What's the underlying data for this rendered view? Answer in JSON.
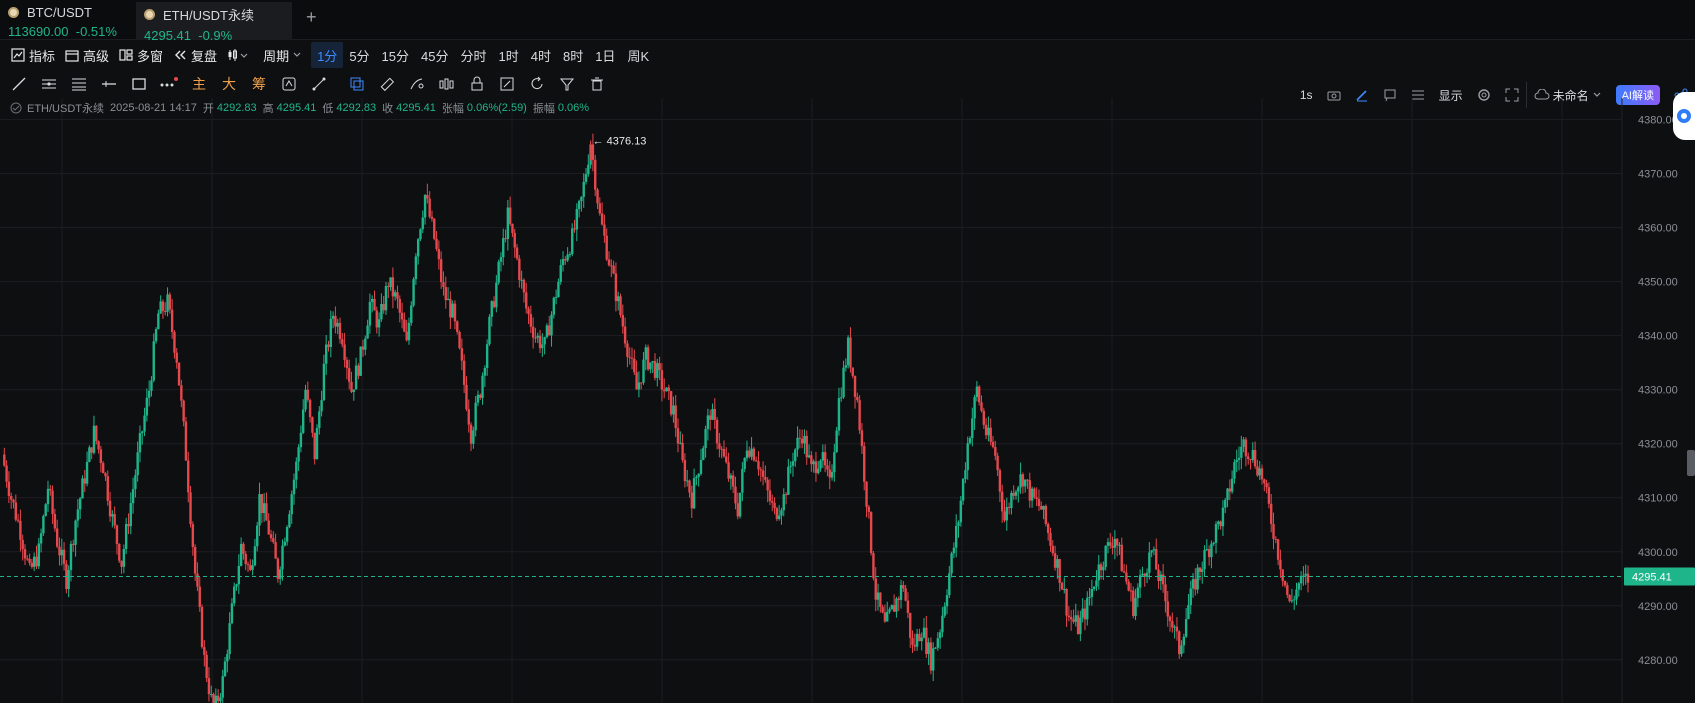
{
  "tabs": [
    {
      "name": "BTC/USDT",
      "price": "113690.00",
      "change": "-0.51%"
    },
    {
      "name": "ETH/USDT永续",
      "price": "4295.41",
      "change": "-0.9%"
    }
  ],
  "toolbar": {
    "indicator": "指标",
    "advanced": "高级",
    "multi_window": "多窗",
    "replay": "复盘",
    "period_menu": "周期",
    "periods": [
      "1分",
      "5分",
      "15分",
      "45分",
      "分时",
      "1时",
      "4时",
      "8时",
      "1日",
      "周K"
    ],
    "active_period": "1分"
  },
  "right_tools": {
    "interval": "1s",
    "display": "显示",
    "layout_name": "未命名",
    "ai_label": "AI解读"
  },
  "drawing_tools": {
    "main_label": "主",
    "big_label": "大",
    "chip_label": "筹"
  },
  "info_bar": {
    "symbol": "ETH/USDT永续",
    "datetime": "2025-08-21 14:17",
    "open_label": "开",
    "open": "4292.83",
    "high_label": "高",
    "high": "4295.41",
    "low_label": "低",
    "low": "4292.83",
    "close_label": "收",
    "close": "4295.41",
    "change_label": "张幅",
    "change": "0.06%(2.59)",
    "amplitude_label": "振幅",
    "amplitude": "0.06%"
  },
  "chart_data": {
    "type": "line",
    "title": "",
    "y_ticks": [
      4280,
      4290,
      4300,
      4310,
      4320,
      4330,
      4340,
      4350,
      4360,
      4370,
      4380
    ],
    "ylim": [
      4272,
      4384
    ],
    "current_price": 4295.41,
    "max_marker": 4376.13,
    "colors": {
      "up": "#1fb58b",
      "down": "#e5484d",
      "grid": "#1c1e22",
      "axis_text": "#8a8f96"
    },
    "series": [
      {
        "values": [
          4318,
          4310,
          4304,
          4296,
          4300,
          4312,
          4302,
          4295,
          4306,
          4314,
          4322,
          4316,
          4306,
          4298,
          4309,
          4320,
          4330,
          4344,
          4346,
          4336,
          4318,
          4296,
          4280,
          4270,
          4276,
          4289,
          4301,
          4296,
          4310,
          4304,
          4296,
          4306,
          4316,
          4330,
          4318,
          4334,
          4344,
          4340,
          4330,
          4336,
          4346,
          4342,
          4350,
          4346,
          4338,
          4356,
          4366,
          4358,
          4348,
          4344,
          4334,
          4322,
          4330,
          4342,
          4352,
          4362,
          4354,
          4345,
          4340,
          4338,
          4346,
          4354,
          4358,
          4365,
          4376,
          4362,
          4354,
          4346,
          4338,
          4330,
          4336,
          4334,
          4330,
          4326,
          4316,
          4310,
          4318,
          4326,
          4320,
          4314,
          4308,
          4320,
          4318,
          4312,
          4307,
          4310,
          4318,
          4322,
          4315,
          4318,
          4312,
          4328,
          4338,
          4328,
          4310,
          4292,
          4286,
          4290,
          4294,
          4282,
          4286,
          4280,
          4286,
          4296,
          4306,
          4320,
          4330,
          4322,
          4318,
          4306,
          4312,
          4314,
          4310,
          4308,
          4302,
          4296,
          4288,
          4286,
          4290,
          4296,
          4300,
          4303,
          4296,
          4290,
          4296,
          4300,
          4294,
          4288,
          4282,
          4290,
          4296,
          4300,
          4304,
          4308,
          4316,
          4320,
          4318,
          4314,
          4306,
          4298,
          4290,
          4294,
          4295
        ]
      }
    ]
  }
}
